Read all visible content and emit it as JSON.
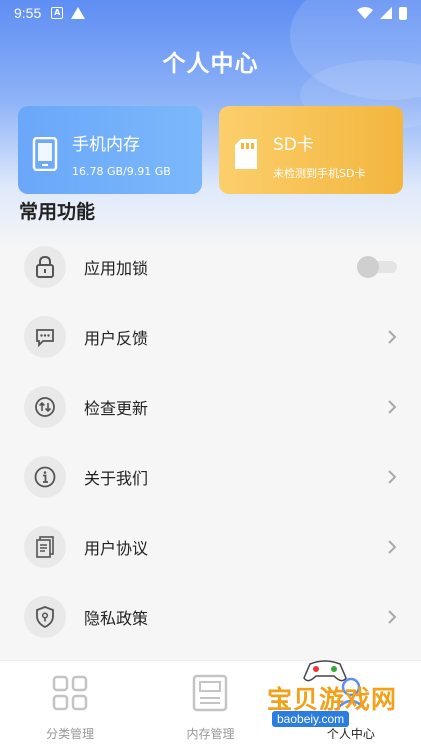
{
  "status_bar": {
    "time": "9:55"
  },
  "header": {
    "title": "个人中心"
  },
  "storage_cards": {
    "phone": {
      "title": "手机内存",
      "subtitle": "16.78 GB/9.91 GB"
    },
    "sd": {
      "title": "SD卡",
      "subtitle": "未检测到手机SD卡"
    }
  },
  "section": {
    "title": "常用功能"
  },
  "menu": {
    "items": [
      {
        "label": "应用加锁",
        "icon": "lock-icon",
        "control": "toggle",
        "toggle_on": false
      },
      {
        "label": "用户反馈",
        "icon": "feedback-icon",
        "control": "arrow"
      },
      {
        "label": "检查更新",
        "icon": "update-icon",
        "control": "arrow"
      },
      {
        "label": "关于我们",
        "icon": "info-icon",
        "control": "arrow"
      },
      {
        "label": "用户协议",
        "icon": "agreement-icon",
        "control": "arrow"
      },
      {
        "label": "隐私政策",
        "icon": "privacy-shield-icon",
        "control": "arrow"
      }
    ]
  },
  "bottom_nav": {
    "items": [
      {
        "label": "分类管理",
        "icon": "category-grid-icon",
        "active": false
      },
      {
        "label": "内存管理",
        "icon": "storage-icon",
        "active": false
      },
      {
        "label": "个人中心",
        "icon": "profile-icon",
        "active": true
      }
    ]
  },
  "watermark": {
    "text": "宝贝游戏网",
    "url": "baobeiy.com"
  },
  "colors": {
    "accent": "#5e8ef3",
    "phone_card": "#6aa7f9",
    "sd_card": "#f3b63e",
    "watermark": "#f2a11b"
  }
}
